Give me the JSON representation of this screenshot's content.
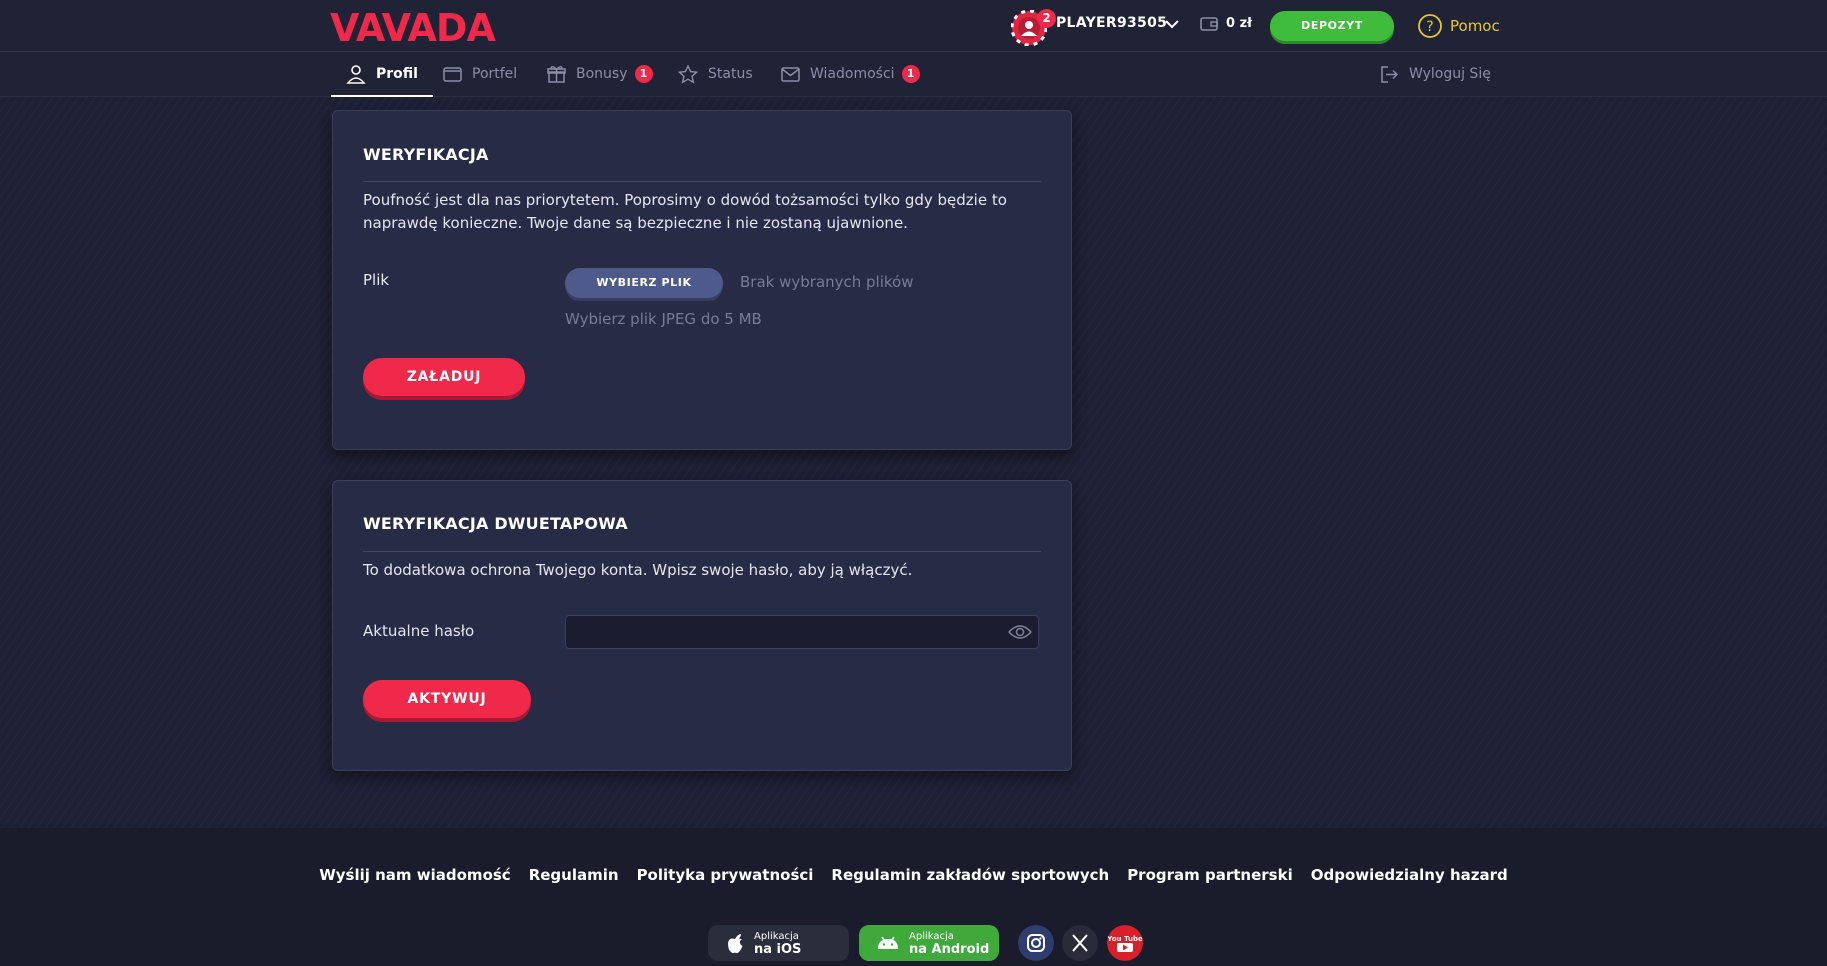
{
  "header": {
    "logo_text": "VAVADA",
    "avatar_badge": "2",
    "username": "PLAYER93505",
    "balance": "0 zł",
    "deposit_label": "DEPOZYT",
    "help_label": "Pomoc"
  },
  "tabs": [
    {
      "label": "Profil",
      "icon": "user-icon",
      "active": true
    },
    {
      "label": "Portfel",
      "icon": "wallet-icon"
    },
    {
      "label": "Bonusy",
      "icon": "gift-icon",
      "badge": "1"
    },
    {
      "label": "Status",
      "icon": "star-icon"
    },
    {
      "label": "Wiadomości",
      "icon": "mail-icon",
      "badge": "1"
    }
  ],
  "logout_label": "Wyloguj Się",
  "verification": {
    "title": "WERYFIKACJA",
    "text": "Poufność jest dla nas priorytetem. Poprosimy o dowód tożsamości tylko gdy będzie to naprawdę konieczne. Twoje dane są bezpieczne i nie zostaną ujawnione.",
    "file_label": "Plik",
    "choose_file_label": "WYBIERZ PLIK",
    "no_file_text": "Brak wybranych plików",
    "hint": "Wybierz plik JPEG do 5 MB",
    "upload_label": "ZAŁADUJ"
  },
  "two_factor": {
    "title": "WERYFIKACJA DWUETAPOWA",
    "text": "To dodatkowa ochrona Twojego konta. Wpisz swoje hasło, aby ją włączyć.",
    "password_label": "Aktualne hasło",
    "password_value": "",
    "activate_label": "AKTYWUJ"
  },
  "footer": {
    "links": [
      "Wyślij nam wiadomość",
      "Regulamin",
      "Polityka prywatności",
      "Regulamin zakładów sportowych",
      "Program partnerski",
      "Odpowiedzialny hazard"
    ],
    "ios": {
      "small": "Aplikacja",
      "big": "na iOS"
    },
    "android": {
      "small": "Aplikacja",
      "big": "na Android"
    },
    "social": [
      "instagram-icon",
      "x-icon",
      "youtube-icon"
    ],
    "youtube_text": "You Tube"
  },
  "colors": {
    "accent_red": "#f0284a",
    "deposit_green": "#3fbc3b",
    "help_yellow": "#e6c832",
    "card_bg": "#272b45"
  }
}
